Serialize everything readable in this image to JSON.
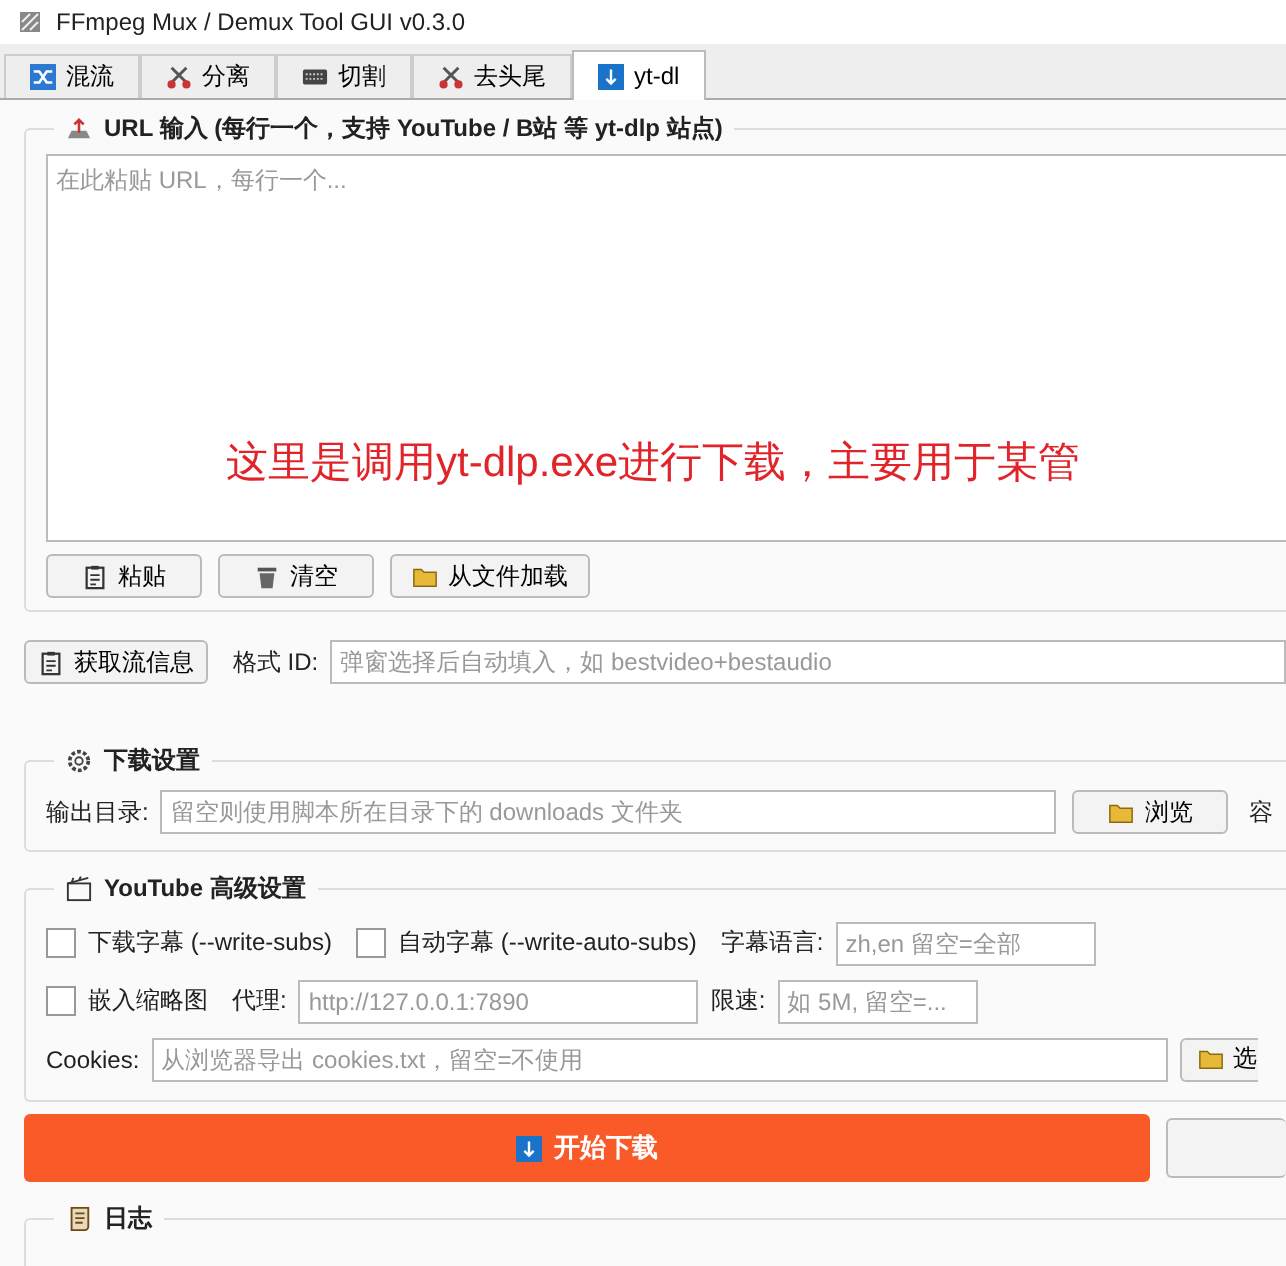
{
  "window": {
    "title": "FFmpeg Mux / Demux Tool GUI v0.3.0"
  },
  "tabs": [
    {
      "label": "混流",
      "kind": "shuffle",
      "selected": false
    },
    {
      "label": "分离",
      "kind": "scissors",
      "selected": false
    },
    {
      "label": "切割",
      "kind": "keyboard",
      "selected": false
    },
    {
      "label": "去头尾",
      "kind": "scissors",
      "selected": false
    },
    {
      "label": "yt-dl",
      "kind": "download",
      "selected": true
    }
  ],
  "url_group": {
    "title": "URL 输入 (每行一个，支持 YouTube / B站 等 yt-dlp 站点)",
    "placeholder": "在此粘贴 URL，每行一个...",
    "annotation": "这里是调用yt-dlp.exe进行下载，主要用于某管",
    "buttons": [
      {
        "label": "粘贴",
        "kind": "clipboard"
      },
      {
        "label": "清空",
        "kind": "trash"
      },
      {
        "label": "从文件加载",
        "kind": "folder"
      }
    ]
  },
  "stream_row": {
    "button": "获取流信息",
    "format_label": "格式 ID:",
    "format_placeholder": "弹窗选择后自动填入，如 bestvideo+bestaudio"
  },
  "download_settings": {
    "title": "下载设置",
    "output_label": "输出目录:",
    "output_placeholder": "留空则使用脚本所在目录下的 downloads 文件夹",
    "browse_button": "浏览",
    "cut_label": "容"
  },
  "youtube_settings": {
    "title": "YouTube 高级设置",
    "options": [
      {
        "label": "下载字幕 (--write-subs)",
        "checked": false
      },
      {
        "label": "自动字幕 (--write-auto-subs)",
        "checked": false
      }
    ],
    "sub_lang_label": "字幕语言:",
    "sub_lang_placeholder": "zh,en 留空=全部",
    "thumbnail": {
      "label": "嵌入缩略图",
      "checked": false
    },
    "proxy_label": "代理:",
    "proxy_placeholder": "http://127.0.0.1:7890",
    "rate_label": "限速:",
    "rate_placeholder": "如 5M, 留空=...",
    "cookies_label": "Cookies:",
    "cookies_placeholder": "从浏览器导出 cookies.txt，留空=不使用",
    "cookies_button": "选"
  },
  "start_button": "开始下载",
  "log_group": {
    "title": "日志"
  }
}
